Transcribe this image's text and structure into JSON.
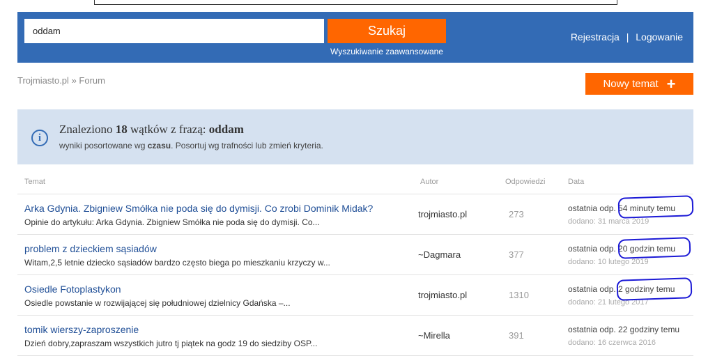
{
  "header": {
    "search_value": "oddam",
    "search_button": "Szukaj",
    "advanced_search": "Wyszukiwanie zaawansowane",
    "register": "Rejestracja",
    "separator": "|",
    "login": "Logowanie"
  },
  "breadcrumb": {
    "home": "Trojmiasto.pl",
    "separator": "»",
    "current": "Forum"
  },
  "new_topic_button": "Nowy temat",
  "info": {
    "title_prefix": "Znaleziono",
    "count": "18",
    "title_middle": "wątków z frazą:",
    "phrase": "oddam",
    "sub_prefix": "wyniki posortowane wg",
    "sort_by": "czasu",
    "sub_suffix": ". Posortuj wg trafności lub zmień kryteria."
  },
  "table": {
    "columns": [
      "Temat",
      "Autor",
      "Odpowiedzi",
      "Data"
    ],
    "rows": [
      {
        "title": "Arka Gdynia. Zbigniew Smółka nie poda się do dymisji. Co zrobi Dominik Midak?",
        "snippet": "Opinie do artykułu: Arka Gdynia. Zbigniew Smółka nie poda się do dymisji. Co...",
        "author": "trojmiasto.pl",
        "replies": "273",
        "last_reply": "ostatnia odp. 54 minuty temu",
        "added": "dodano: 31 marca 2019"
      },
      {
        "title": "problem z dzieckiem sąsiadów",
        "snippet": "Witam,2,5 letnie dziecko sąsiadów bardzo często biega po mieszkaniu krzyczy w...",
        "author": "~Dagmara",
        "replies": "377",
        "last_reply": "ostatnia odp. 20 godzin temu",
        "added": "dodano: 10 lutego 2019"
      },
      {
        "title": "Osiedle Fotoplastykon",
        "snippet": "Osiedle powstanie w rozwijającej się południowej dzielnicy Gdańska –...",
        "author": "trojmiasto.pl",
        "replies": "1310",
        "last_reply": "ostatnia odp. 2 godziny temu",
        "added": "dodano: 21 lutego 2017"
      },
      {
        "title": "tomik wierszy-zaproszenie",
        "snippet": "Dzień dobry,zapraszam wszystkich jutro tj piątek na godz 19 do siedziby OSP...",
        "author": "~Mirella",
        "replies": "391",
        "last_reply": "ostatnia odp. 22 godziny temu",
        "added": "dodano: 16 czerwca 2016"
      }
    ]
  },
  "annotation_color": "#1c1ad6",
  "accent_color": "#ff6600",
  "header_color": "#336bb5"
}
